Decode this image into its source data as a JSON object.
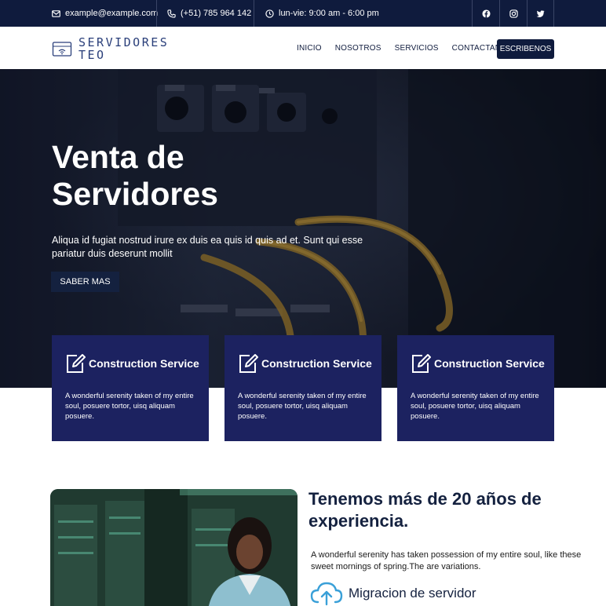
{
  "topbar": {
    "email": "example@example.com",
    "phone": "(+51) 785 964 142",
    "hours": "lun-vie: 9:00 am - 6:00 pm",
    "social": [
      "facebook-icon",
      "instagram-icon",
      "twitter-icon"
    ]
  },
  "header": {
    "logo_line1": "SERVIDORES",
    "logo_line2": "TEO",
    "nav": [
      "INICIO",
      "NOSOTROS",
      "SERVICIOS",
      "CONTACTANOS"
    ],
    "cta": "ESCRIBENOS"
  },
  "hero": {
    "title_line1": "Venta de",
    "title_line2": "Servidores",
    "subtitle": "Aliqua id fugiat nostrud irure ex duis ea quis id quis ad et. Sunt qui esse pariatur duis deserunt mollit",
    "button": "SABER MAS"
  },
  "cards": [
    {
      "title": "Construction Service",
      "text": "A wonderful serenity taken of my entire soul, posuere tortor, uisq aliquam posuere."
    },
    {
      "title": "Construction Service",
      "text": "A wonderful serenity taken of my entire soul, posuere tortor, uisq aliquam posuere."
    },
    {
      "title": "Construction Service",
      "text": "A wonderful serenity taken of my entire soul, posuere tortor, uisq aliquam posuere."
    }
  ],
  "about": {
    "title": "Tenemos más de 20 años de experiencia.",
    "text": "A wonderful serenity has taken possession of my entire soul, like these sweet mornings of spring.The are variations.",
    "feature": "Migracion de servidor"
  },
  "colors": {
    "navy": "#0f1b3d",
    "card": "#1c2260",
    "accent_blue": "#3aa0d8"
  }
}
